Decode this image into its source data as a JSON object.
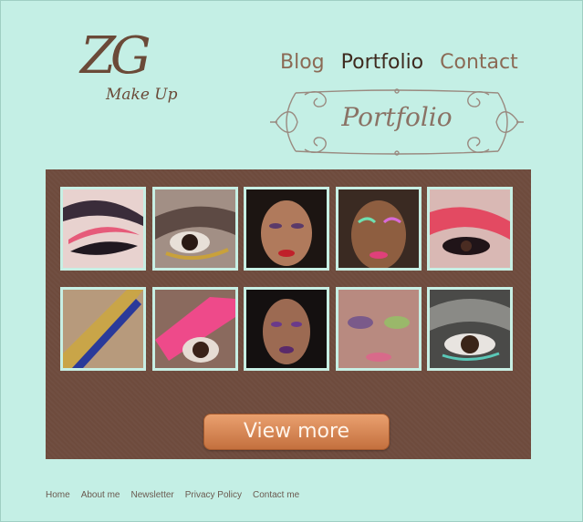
{
  "logo": {
    "monogram": "ZG",
    "subtitle": "Make Up"
  },
  "nav": {
    "items": [
      "Blog",
      "Portfolio",
      "Contact"
    ],
    "active": "Portfolio"
  },
  "banner": {
    "title": "Portfolio"
  },
  "gallery": {
    "photos": [
      {
        "name": "eye-pink-black"
      },
      {
        "name": "eye-smoky-brown"
      },
      {
        "name": "face-purple-red-lip"
      },
      {
        "name": "face-green-pink"
      },
      {
        "name": "eye-pink-red"
      },
      {
        "name": "eye-gold-blue"
      },
      {
        "name": "eye-pink-bold"
      },
      {
        "name": "face-purple-lip"
      },
      {
        "name": "face-pink-green"
      },
      {
        "name": "eye-smoky-silver"
      }
    ]
  },
  "view_more": {
    "label": "View more"
  },
  "footer": {
    "links": [
      "Home",
      "About me",
      "Newsletter",
      "Privacy Policy",
      "Contact me"
    ]
  }
}
